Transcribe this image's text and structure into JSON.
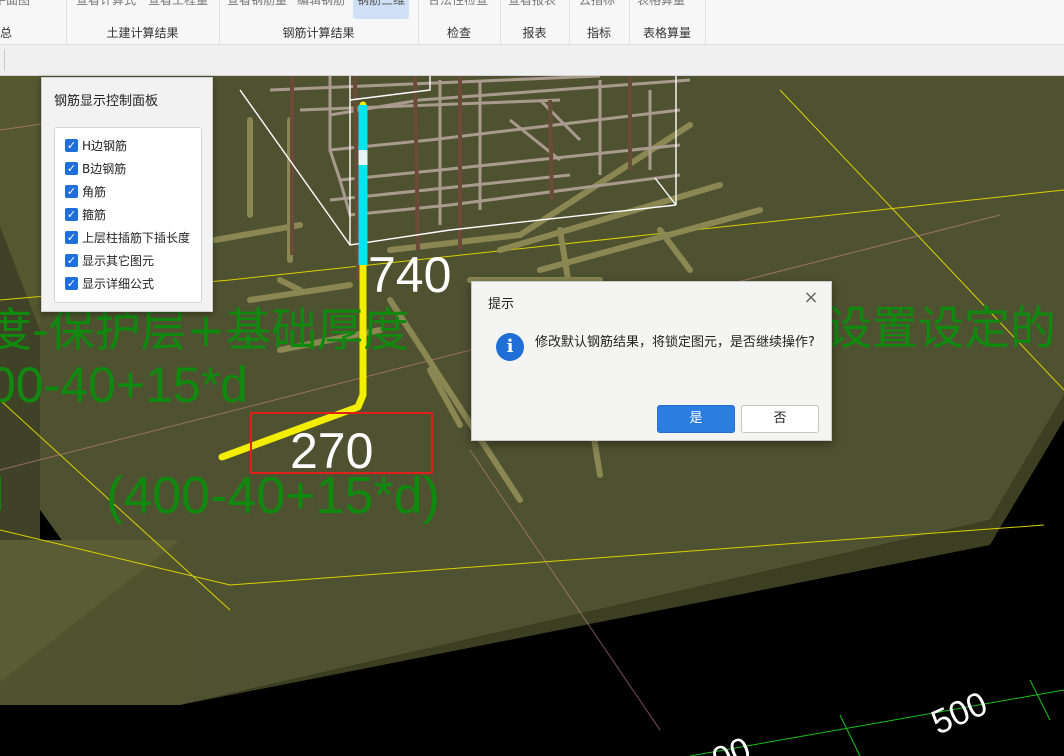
{
  "ribbon": {
    "groups": [
      {
        "label": "总",
        "buttons": [
          "显示平面图"
        ],
        "highlight": false
      },
      {
        "label": "土建计算结果",
        "buttons": [
          "查看计算式",
          "查看工程量"
        ],
        "highlight": false
      },
      {
        "label": "钢筋计算结果",
        "buttons": [
          "查看钢筋量",
          "编辑钢筋",
          "钢筋三维"
        ],
        "highlight": true
      },
      {
        "label": "检查",
        "buttons": [
          "合法性检查"
        ],
        "highlight": false
      },
      {
        "label": "报表",
        "buttons": [
          "查看报表"
        ],
        "highlight": false
      },
      {
        "label": "指标",
        "buttons": [
          "云指标"
        ],
        "highlight": false
      },
      {
        "label": "表格算量",
        "buttons": [
          "表格算量"
        ],
        "highlight": false
      }
    ]
  },
  "panel": {
    "title": "钢筋显示控制面板",
    "options": [
      {
        "label": "H边钢筋",
        "checked": true
      },
      {
        "label": "B边钢筋",
        "checked": true
      },
      {
        "label": "角筋",
        "checked": true
      },
      {
        "label": "箍筋",
        "checked": true
      },
      {
        "label": "上层柱插筋下插长度",
        "checked": true
      },
      {
        "label": "显示其它图元",
        "checked": true
      },
      {
        "label": "显示详细公式",
        "checked": true
      }
    ]
  },
  "scene": {
    "dim_740": "740",
    "dim_270": "270",
    "formula_line1": "度-保护层+基础厚度",
    "formula_line1_right": "设置设定的",
    "formula_line2": "00-40+15*d",
    "formula_270": "(400-40+15*d)",
    "dim_500": "500",
    "dim_partial": "00"
  },
  "dialog": {
    "title": "提示",
    "icon": "info-icon",
    "message": "修改默认钢筋结果，将锁定图元，是否继续操作?",
    "yes_label": "是",
    "no_label": "否"
  },
  "colors": {
    "slab": "#4f5230",
    "rebar_highlight": "#f3ee00",
    "rebar_cyan": "#00e5ee",
    "formula_text": "#0f8a0f",
    "accent": "#2b7de0",
    "select_box": "#e0201a"
  }
}
